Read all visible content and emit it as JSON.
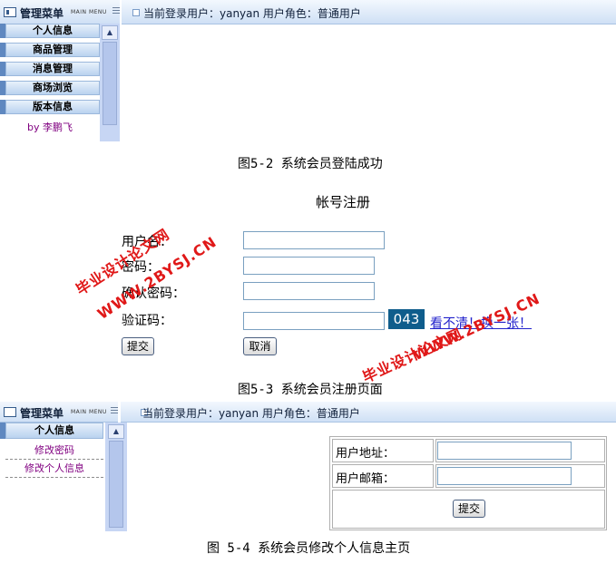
{
  "figure_52": {
    "menu_title": "管理菜单",
    "menu_subtitle": "MAIN MENU",
    "user_status": "当前登录用户：yanyan 用户角色：普通用户",
    "menu_items": [
      "个人信息",
      "商品管理",
      "消息管理",
      "商场浏览",
      "版本信息"
    ],
    "byline": "by 李鹏飞",
    "caption": "图5-2 系统会员登陆成功"
  },
  "figure_53": {
    "title": "帐号注册",
    "labels": {
      "username": "用户名：",
      "password": "密码：",
      "confirm_password": "确认密码：",
      "captcha": "验证码："
    },
    "captcha_value": "043",
    "captcha_refresh": "看不清！换一张！",
    "submit_label": "提交",
    "cancel_label": "取消",
    "caption": "图5-3 系统会员注册页面",
    "watermarks": [
      "毕业设计论文网",
      "WWW.2BYSJ.CN"
    ]
  },
  "figure_54": {
    "menu_title": "管理菜单",
    "menu_subtitle": "MAIN MENU",
    "user_status": "当前登录用户：yanyan 用户角色：普通用户",
    "menu_group": "个人信息",
    "sub_items": [
      "修改密码",
      "修改个人信息"
    ],
    "address_label": "用户地址：",
    "email_label": "用户邮箱：",
    "submit_label": "提交",
    "caption": "图 5-4 系统会员修改个人信息主页"
  },
  "colors": {
    "accent_blue": "#cfe0f5",
    "menu_link": "#800080",
    "watermark_red": "#e01818",
    "captcha_bg": "#0f5d8c"
  }
}
